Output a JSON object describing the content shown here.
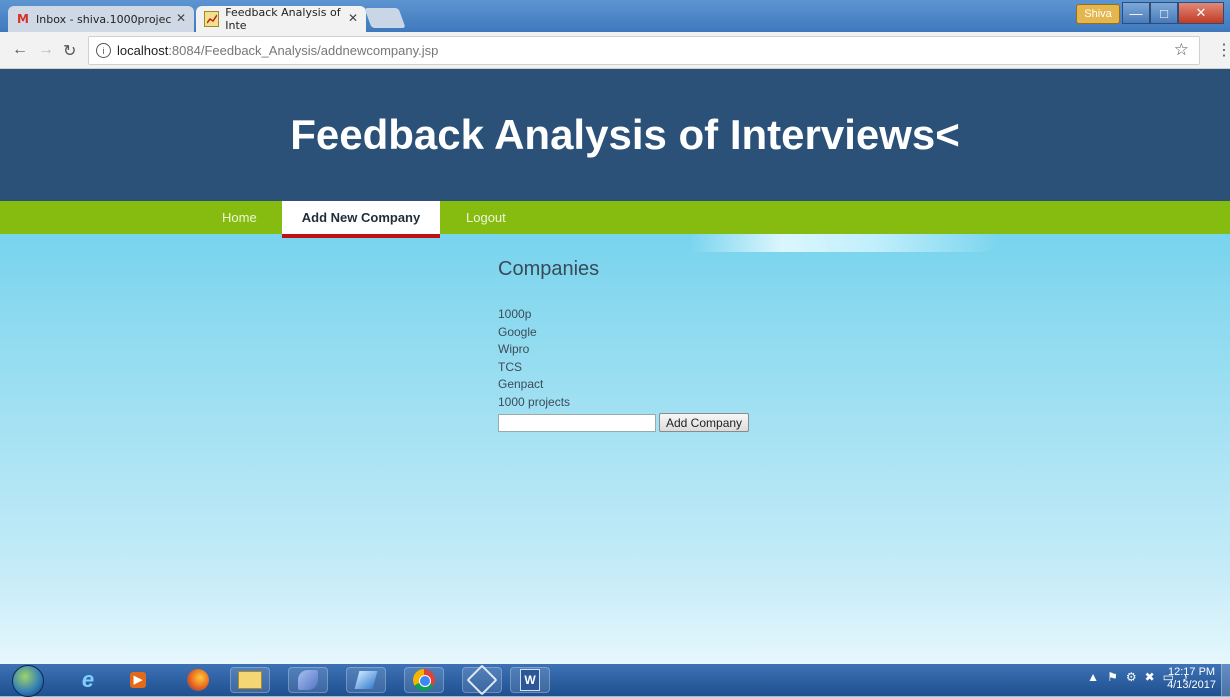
{
  "browser": {
    "tabs": [
      {
        "title": "Inbox - shiva.1000projec",
        "icon": "gmail-icon"
      },
      {
        "title": "Feedback Analysis of Inte",
        "icon": "chart-favicon"
      }
    ],
    "user_badge": "Shiva",
    "url_host": "localhost",
    "url_path": ":8084/Feedback_Analysis/addnewcompany.jsp"
  },
  "page": {
    "title": "Feedback Analysis of Interviews<",
    "menu": [
      {
        "label": "Home"
      },
      {
        "label": "Add New Company"
      },
      {
        "label": "Logout"
      }
    ],
    "section_heading": "Companies",
    "companies": [
      "1000p",
      "Google",
      "Wipro",
      "TCS",
      "Genpact",
      "1000 projects"
    ],
    "input_placeholder": "",
    "add_button": "Add Company"
  },
  "taskbar": {
    "time": "12:17 PM",
    "date": "4/13/2017"
  },
  "colors": {
    "header_bg": "#2b5178",
    "menubar_bg": "#86bb10",
    "active_tab_underline": "#c01016"
  }
}
